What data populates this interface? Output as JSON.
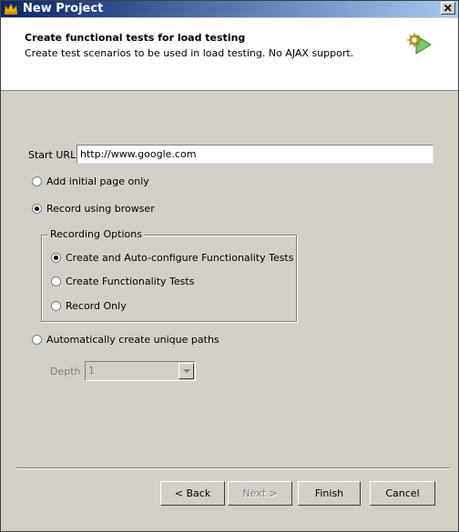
{
  "window": {
    "title": "New Project",
    "title_icon": "crown-icon",
    "close_icon": "close-icon"
  },
  "header": {
    "title": "Create functional tests for load testing",
    "subtitle": "Create test scenarios to be used in load testing. No AJAX support.",
    "icon": "wizard-icon"
  },
  "form": {
    "start_url_label": "Start URL",
    "start_url_value": "http://www.google.com",
    "option_initial_page": "Add initial page only",
    "option_record_browser": "Record using browser",
    "recording_options": {
      "legend": "Recording Options",
      "option_auto_configure": "Create and Auto-configure Functionality Tests",
      "option_functionality": "Create Functionality Tests",
      "option_record_only": "Record Only"
    },
    "option_unique_paths": "Automatically create unique paths",
    "depth_label": "Depth",
    "depth_value": "1"
  },
  "buttons": {
    "back": "< Back",
    "next": "Next >",
    "finish": "Finish",
    "cancel": "Cancel"
  }
}
